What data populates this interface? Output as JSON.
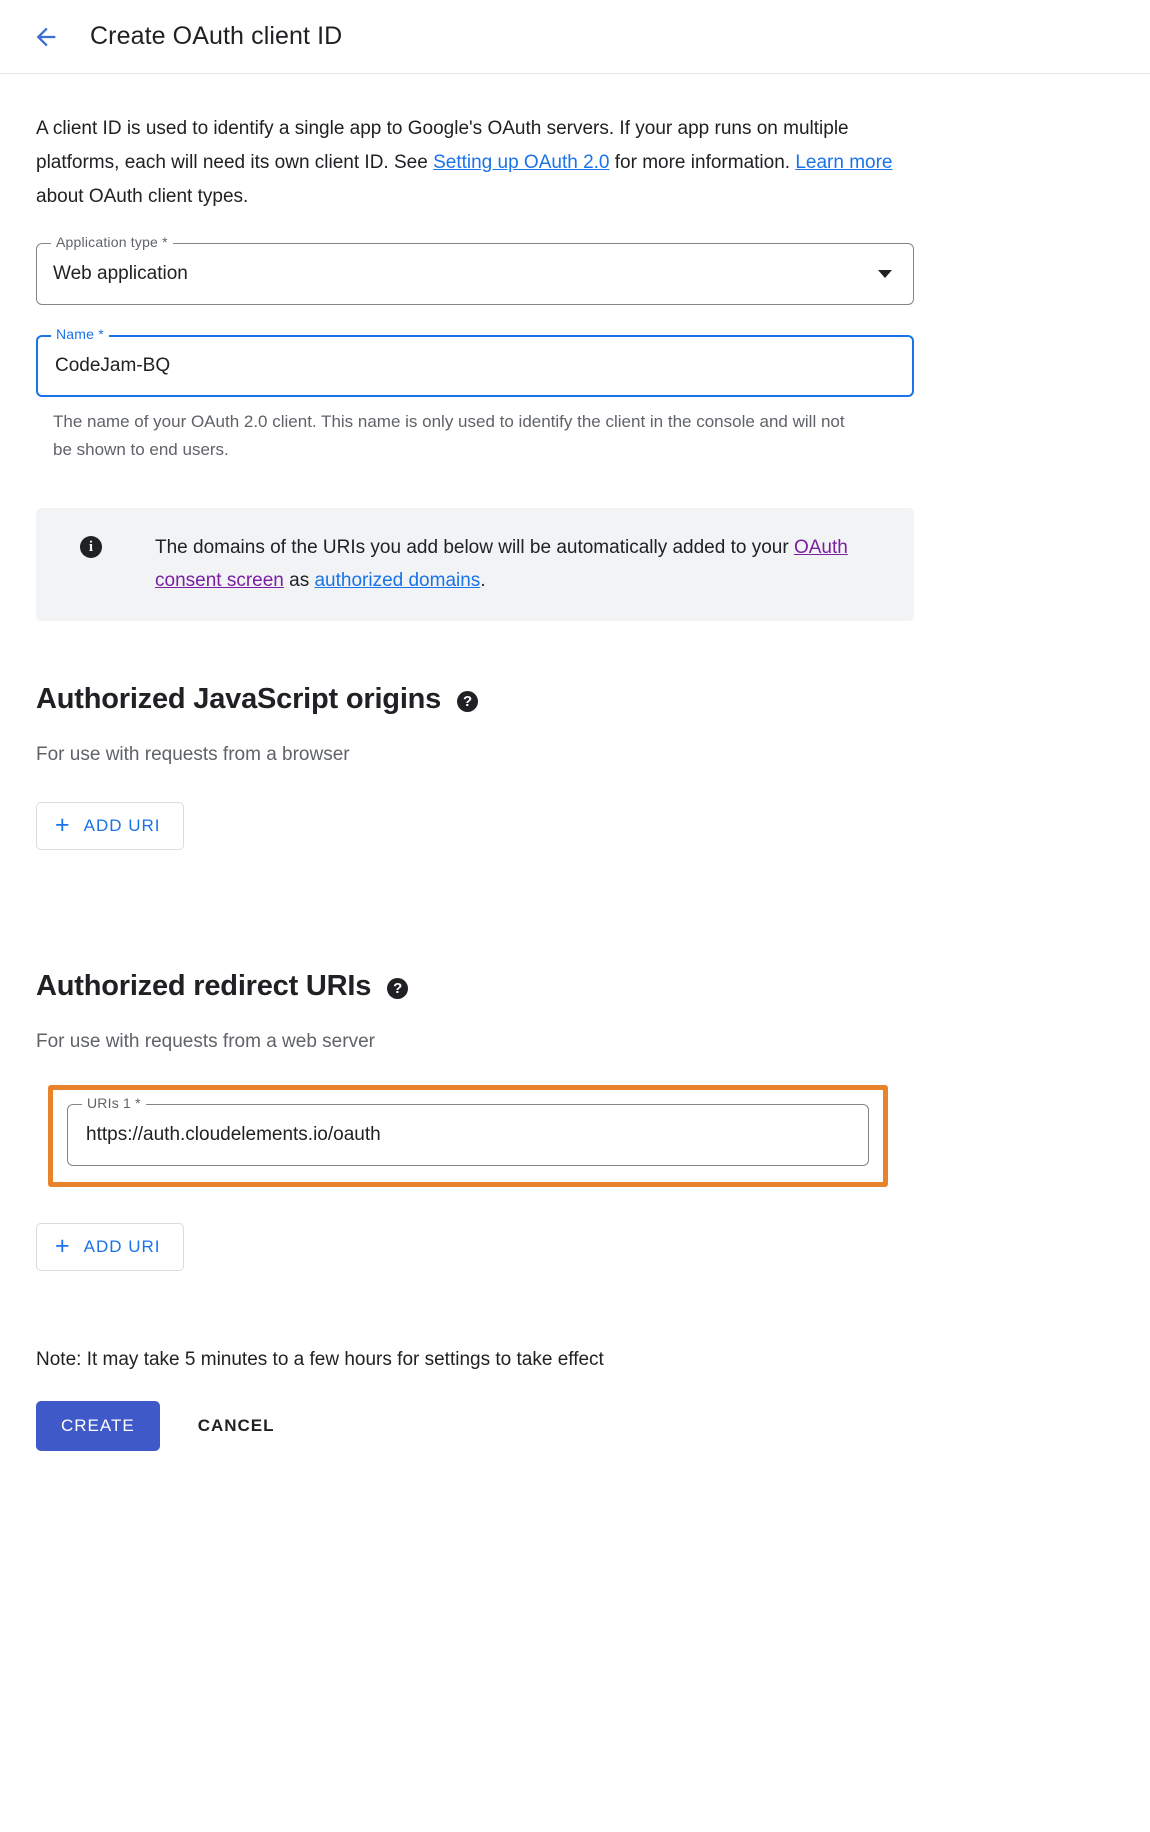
{
  "header": {
    "back_icon": "arrow-left-icon",
    "title": "Create OAuth client ID"
  },
  "intro": {
    "part1": "A client ID is used to identify a single app to Google's OAuth servers. If your app runs on multiple platforms, each will need its own client ID. See ",
    "link1": "Setting up OAuth 2.0",
    "part2": " for more information. ",
    "link2": "Learn more",
    "part3": " about OAuth client types."
  },
  "app_type_field": {
    "label": "Application type *",
    "value": "Web application",
    "dropdown_icon": "chevron-down-icon"
  },
  "name_field": {
    "label": "Name *",
    "value": "CodeJam-BQ",
    "helper": "The name of your OAuth 2.0 client. This name is only used to identify the client in the console and will not be shown to end users."
  },
  "info_banner": {
    "icon": "info-icon",
    "part1": "The domains of the URIs you add below will be automatically added to your ",
    "link1": "OAuth consent screen",
    "part2": " as ",
    "link2": "authorized domains",
    "part3": "."
  },
  "js_origins": {
    "title": "Authorized JavaScript origins",
    "help_icon": "help-icon",
    "subtitle": "For use with requests from a browser",
    "add_button": "ADD URI",
    "add_icon": "plus-icon"
  },
  "redirect_uris": {
    "title": "Authorized redirect URIs",
    "help_icon": "help-icon",
    "subtitle": "For use with requests from a web server",
    "uri_field": {
      "label": "URIs 1 *",
      "value": "https://auth.cloudelements.io/oauth"
    },
    "add_button": "ADD URI",
    "add_icon": "plus-icon",
    "highlight_color": "#e8822b"
  },
  "footer": {
    "note": "Note: It may take 5 minutes to a few hours for settings to take effect",
    "create_label": "CREATE",
    "cancel_label": "CANCEL",
    "create_color": "#4059c9"
  }
}
